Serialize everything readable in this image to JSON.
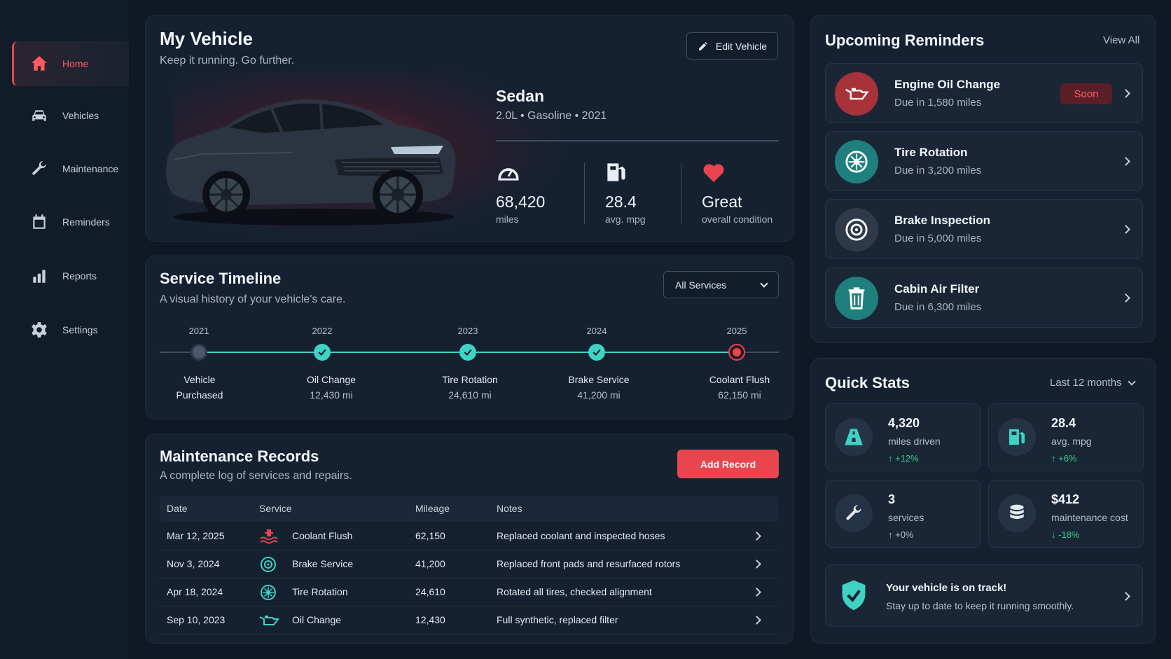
{
  "sidebar": {
    "items": [
      {
        "label": "Home",
        "icon": "home-icon"
      },
      {
        "label": "Vehicles",
        "icon": "car-icon"
      },
      {
        "label": "Maintenance",
        "icon": "wrench-icon"
      },
      {
        "label": "Reminders",
        "icon": "calendar-icon"
      },
      {
        "label": "Reports",
        "icon": "bar-chart-icon"
      },
      {
        "label": "Settings",
        "icon": "gear-icon"
      }
    ]
  },
  "vehicle": {
    "title": "My Vehicle",
    "subtitle": "Keep it running. Go further.",
    "edit_label": "Edit Vehicle",
    "model": "Sedan",
    "specs": "2.0L • Gasoline • 2021",
    "stats": [
      {
        "value": "68,420",
        "label": "miles",
        "icon": "speedometer-icon"
      },
      {
        "value": "28.4",
        "label": "avg. mpg",
        "icon": "fuel-pump-icon"
      },
      {
        "value": "Great",
        "label": "overall condition",
        "icon": "heart-icon"
      }
    ]
  },
  "timeline": {
    "title": "Service Timeline",
    "subtitle": "A visual history of your vehicle's care.",
    "filter": "All Services",
    "events": [
      {
        "year": "2021",
        "line1": "Vehicle",
        "line2": "Purchased",
        "status": "start"
      },
      {
        "year": "2022",
        "line1": "Oil Change",
        "line2": "12,430 mi",
        "status": "done"
      },
      {
        "year": "2023",
        "line1": "Tire Rotation",
        "line2": "24,610 mi",
        "status": "done"
      },
      {
        "year": "2024",
        "line1": "Brake Service",
        "line2": "41,200 mi",
        "status": "done"
      },
      {
        "year": "2025",
        "line1": "Coolant Flush",
        "line2": "62,150 mi",
        "status": "current"
      }
    ]
  },
  "records": {
    "title": "Maintenance Records",
    "subtitle": "A complete log of services and repairs.",
    "add_label": "Add Record",
    "columns": [
      "Date",
      "Service",
      "Mileage",
      "Notes"
    ],
    "rows": [
      {
        "date": "Mar 12, 2025",
        "service": "Coolant Flush",
        "icon": "coolant-icon",
        "mileage": "62,150",
        "notes": "Replaced coolant and inspected hoses"
      },
      {
        "date": "Nov 3, 2024",
        "service": "Brake Service",
        "icon": "brake-icon",
        "mileage": "41,200",
        "notes": "Replaced front pads and resurfaced rotors"
      },
      {
        "date": "Apr 18, 2024",
        "service": "Tire Rotation",
        "icon": "tire-icon",
        "mileage": "24,610",
        "notes": "Rotated all tires, checked alignment"
      },
      {
        "date": "Sep 10, 2023",
        "service": "Oil Change",
        "icon": "oil-can-icon",
        "mileage": "12,430",
        "notes": "Full synthetic, replaced filter"
      }
    ]
  },
  "reminders": {
    "title": "Upcoming Reminders",
    "view_all": "View All",
    "items": [
      {
        "title": "Engine Oil Change",
        "due": "Due in 1,580 miles",
        "badge": "Soon",
        "icon": "oil-can-icon",
        "color": "#a8323a"
      },
      {
        "title": "Tire Rotation",
        "due": "Due in 3,200 miles",
        "badge": "",
        "icon": "tire-icon",
        "color": "#1f7f7c"
      },
      {
        "title": "Brake Inspection",
        "due": "Due in 5,000 miles",
        "badge": "",
        "icon": "brake-icon",
        "color": "#2e3a4a"
      },
      {
        "title": "Cabin Air Filter",
        "due": "Due in 6,300 miles",
        "badge": "",
        "icon": "filter-icon",
        "color": "#1f7f7c"
      }
    ]
  },
  "quick_stats": {
    "title": "Quick Stats",
    "range": "Last 12 months",
    "items": [
      {
        "value": "4,320",
        "label": "miles driven",
        "change": "↑ +12%",
        "trend": "up",
        "icon": "road-icon"
      },
      {
        "value": "28.4",
        "label": "avg. mpg",
        "change": "↑ +6%",
        "trend": "up",
        "icon": "fuel-pump-icon"
      },
      {
        "value": "3",
        "label": "services",
        "change": "↑ +0%",
        "trend": "flat",
        "icon": "wrench-icon"
      },
      {
        "value": "$412",
        "label": "maintenance cost",
        "change": "↓ -18%",
        "trend": "down",
        "icon": "coins-icon"
      }
    ],
    "status_title": "Your vehicle is on track!",
    "status_text": "Stay up to date to keep it running smoothly."
  },
  "colors": {
    "accent": "#e8454f",
    "teal": "#3fd2c2",
    "green": "#2fd38a"
  }
}
